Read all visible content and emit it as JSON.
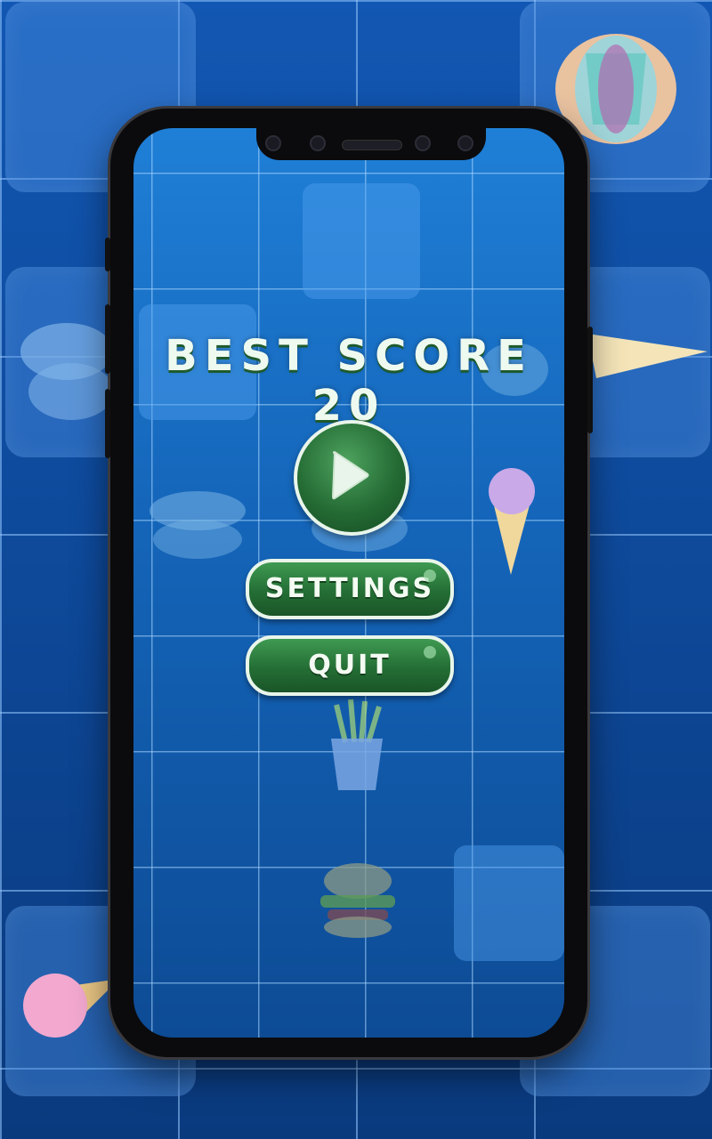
{
  "menu": {
    "best_score": "BEST SCORE 20",
    "play_label": "",
    "settings_label": "SETTINGS",
    "quit_label": "QUIT"
  },
  "icons": {
    "play": "play-triangle-icon",
    "foods": [
      "hotdog-icon",
      "burger-icon",
      "ice-cream-icon",
      "fries-icon"
    ]
  },
  "colors": {
    "background": "#0e4a9c",
    "button_green": "#246e35",
    "button_border": "#e9f5ea",
    "title_text": "#eefaf0"
  }
}
